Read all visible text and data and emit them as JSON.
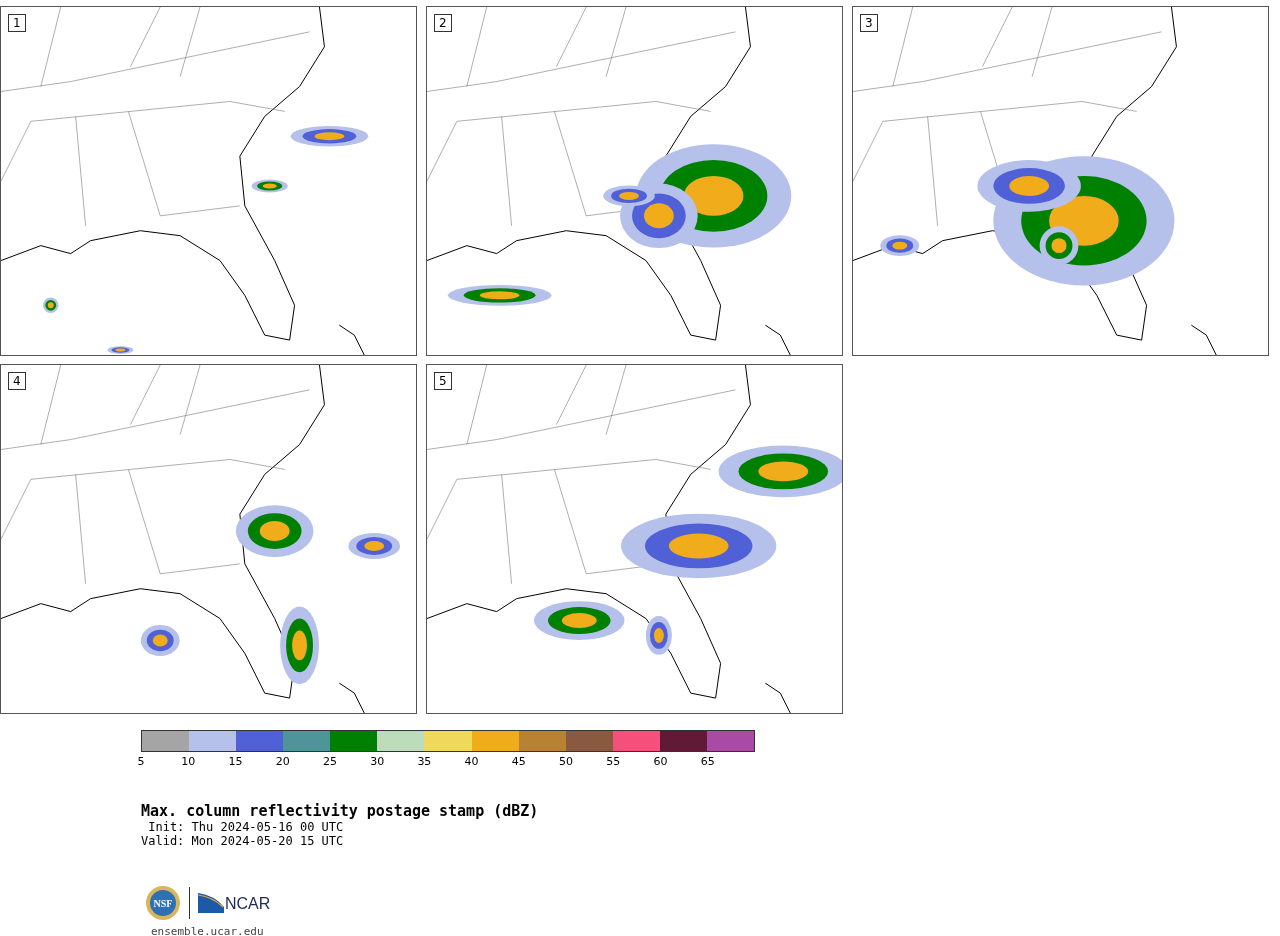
{
  "panels": [
    {
      "label": "1",
      "kind": "map-picture"
    },
    {
      "label": "2",
      "kind": "map-picture"
    },
    {
      "label": "3",
      "kind": "map-picture"
    },
    {
      "label": "4",
      "kind": "map-picture"
    },
    {
      "label": "5",
      "kind": "map-picture"
    }
  ],
  "colorbar": {
    "segments": [
      {
        "color": "#a5a5a5",
        "tick": "5"
      },
      {
        "color": "#b5c0eb",
        "tick": "10"
      },
      {
        "color": "#5060d6",
        "tick": "15"
      },
      {
        "color": "#4e959a",
        "tick": "20"
      },
      {
        "color": "#008000",
        "tick": "25"
      },
      {
        "color": "#bcdcbc",
        "tick": "30"
      },
      {
        "color": "#efd95c",
        "tick": "35"
      },
      {
        "color": "#f0ac1a",
        "tick": "40"
      },
      {
        "color": "#b88232",
        "tick": "45"
      },
      {
        "color": "#8a5a40",
        "tick": "50"
      },
      {
        "color": "#f54f7c",
        "tick": "55"
      },
      {
        "color": "#611935",
        "tick": "60"
      },
      {
        "color": "#a94ba4",
        "tick": "65"
      }
    ]
  },
  "title": "Max. column reflectivity postage stamp (dBZ)",
  "init": " Init: Thu 2024-05-16 00 UTC",
  "valid": "Valid: Mon 2024-05-20 15 UTC",
  "logos": {
    "nsf": "NSF",
    "ncar": "NCAR"
  },
  "site": "ensemble.ucar.edu"
}
